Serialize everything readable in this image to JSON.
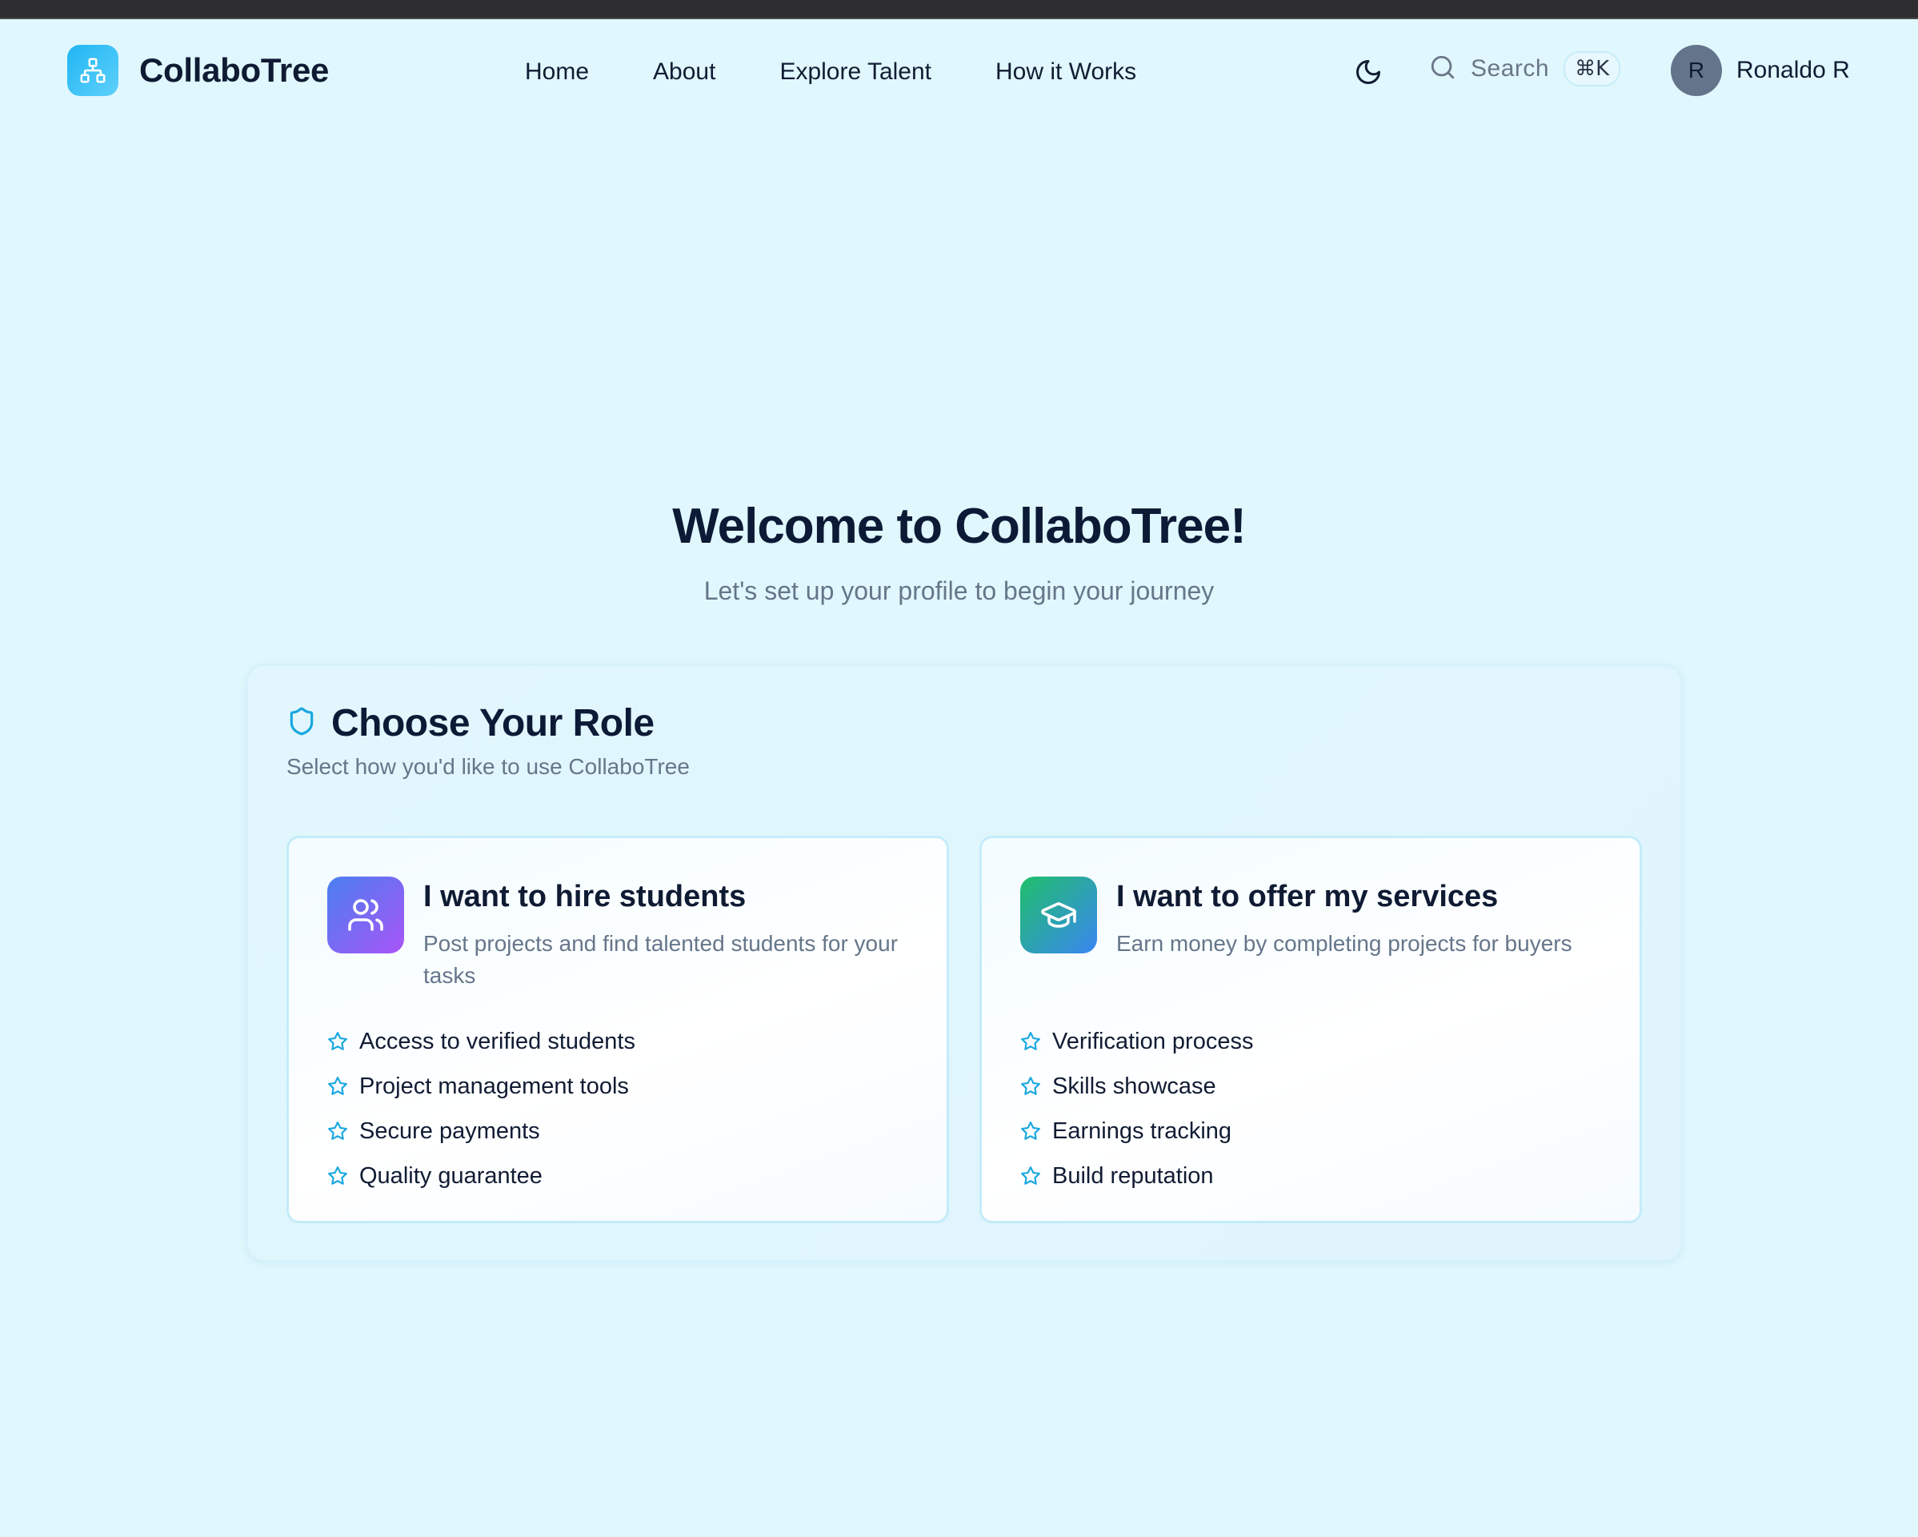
{
  "header": {
    "brand": "CollaboTree",
    "nav": [
      {
        "label": "Home"
      },
      {
        "label": "About"
      },
      {
        "label": "Explore Talent"
      },
      {
        "label": "How it Works"
      }
    ],
    "search_label": "Search",
    "search_shortcut": "⌘K",
    "user": {
      "initial": "R",
      "name": "Ronaldo R"
    }
  },
  "hero": {
    "title": "Welcome to CollaboTree!",
    "subtitle": "Let's set up your profile to begin your journey"
  },
  "role_panel": {
    "title": "Choose Your Role",
    "subtitle": "Select how you'd like to use CollaboTree",
    "options": [
      {
        "title": "I want to hire students",
        "description": "Post projects and find talented students for your tasks",
        "icon": "users-icon",
        "features": [
          "Access to verified students",
          "Project management tools",
          "Secure payments",
          "Quality guarantee"
        ]
      },
      {
        "title": "I want to offer my services",
        "description": "Earn money by completing projects for buyers",
        "icon": "graduation-cap-icon",
        "features": [
          "Verification process",
          "Skills showcase",
          "Earnings tracking",
          "Build reputation"
        ]
      }
    ]
  },
  "colors": {
    "background": "#e0f7fd",
    "accent": "#1fb6f3",
    "text_primary": "#0f1b33",
    "text_muted": "#66768a"
  }
}
